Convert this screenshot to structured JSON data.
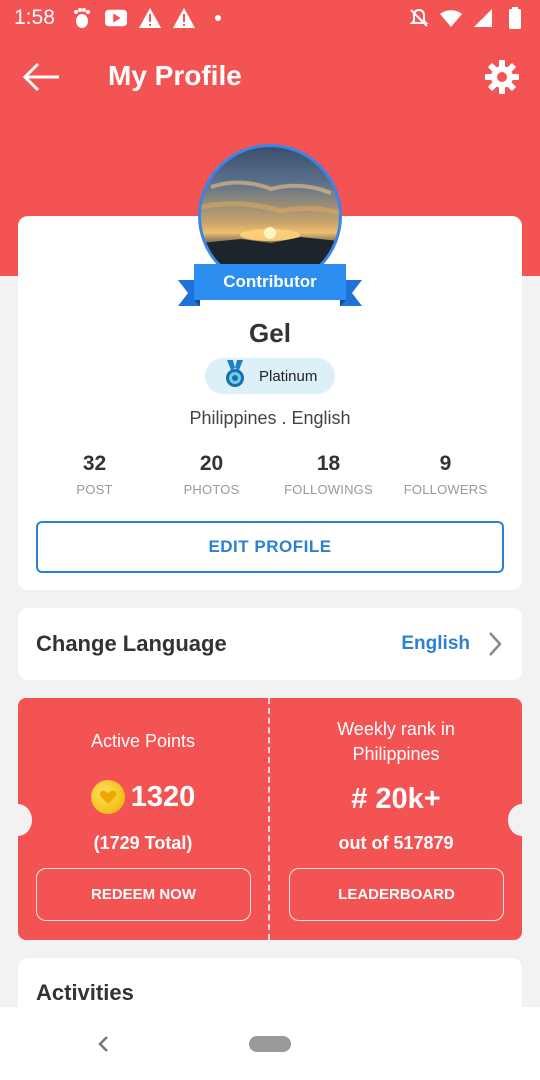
{
  "status_bar": {
    "time": "1:58",
    "left_icons": [
      "footprint-icon",
      "youtube-icon",
      "warning-icon",
      "warning-icon",
      "dot-icon"
    ],
    "right_icons": [
      "mute-icon",
      "wifi-icon",
      "signal-icon",
      "battery-icon"
    ]
  },
  "app_bar": {
    "title": "My Profile"
  },
  "profile": {
    "badge_label": "Contributor",
    "name": "Gel",
    "tier": "Platinum",
    "location": "Philippines . English",
    "stats": [
      {
        "value": "32",
        "label": "POST"
      },
      {
        "value": "20",
        "label": "PHOTOS"
      },
      {
        "value": "18",
        "label": "FOLLOWINGS"
      },
      {
        "value": "9",
        "label": "FOLLOWERS"
      }
    ],
    "edit_button": "EDIT PROFILE"
  },
  "language": {
    "title": "Change Language",
    "value": "English"
  },
  "points": {
    "active_label": "Active Points",
    "active_value": "1320",
    "total": "(1729 Total)",
    "redeem_button": "REDEEM NOW",
    "rank_label_line1": "Weekly rank in",
    "rank_label_line2": "Philippines",
    "rank_value": "# 20k+",
    "rank_sub": "out of 517879",
    "leaderboard_button": "LEADERBOARD"
  },
  "activities": {
    "title": "Activities"
  },
  "colors": {
    "accent_red": "#f45353",
    "accent_blue": "#2b7fd4",
    "tier_bg": "#dcf0f8",
    "coin": "#f5c31c"
  }
}
